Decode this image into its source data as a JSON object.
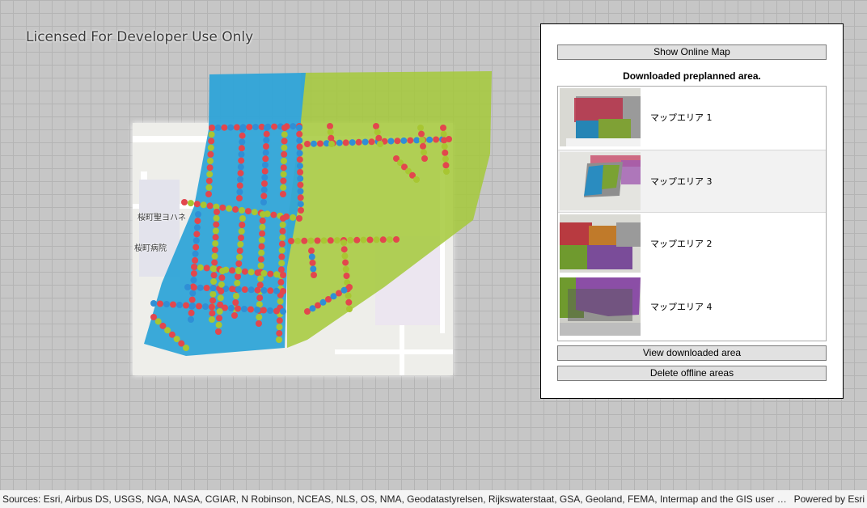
{
  "map": {
    "watermark": "Licensed For Developer Use Only",
    "labels": [
      "桜町聖ヨハネ",
      "桜町病院"
    ],
    "colors": {
      "background": "#c6c6c6",
      "basemap": "#eeeeea",
      "blue_area": "#2fa4d8",
      "green_area": "#a5c93a",
      "point_red": "#e2474d",
      "point_blue": "#2f8fd6",
      "point_green": "#a8c632"
    }
  },
  "panel": {
    "show_online_label": "Show Online Map",
    "title": "Downloaded preplanned area.",
    "areas": [
      {
        "label": "マップエリア 1",
        "selected": false
      },
      {
        "label": "マップエリア 3",
        "selected": true
      },
      {
        "label": "マップエリア 2",
        "selected": false
      },
      {
        "label": "マップエリア 4",
        "selected": false
      }
    ],
    "view_label": "View downloaded area",
    "delete_label": "Delete offline areas"
  },
  "footer": {
    "attribution": "Sources: Esri, Airbus DS, USGS, NGA, NASA, CGIAR, N Robinson, NCEAS, NLS, OS, NMA, Geodatastyrelsen, Rijkswaterstaat, GSA, Geoland, FEMA, Intermap and the GIS user community,...",
    "powered_by": "Powered by Esri"
  }
}
